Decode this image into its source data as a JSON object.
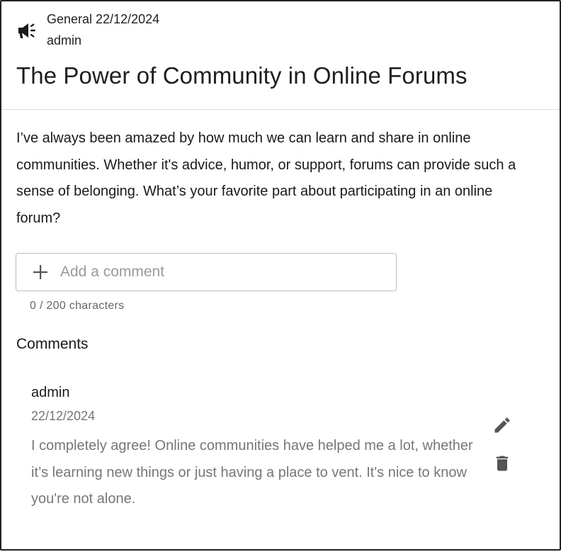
{
  "post": {
    "category": "General",
    "date": "22/12/2024",
    "author": "admin",
    "category_icon": "megaphone-icon",
    "title": "The Power of Community in Online Forums",
    "body": "I’ve always been amazed by how much we can learn and share in online communities. Whether it's advice, humor, or support, forums can provide such a sense of belonging. What’s your favorite part about participating in an online forum?"
  },
  "comment_input": {
    "placeholder": "Add a comment",
    "value": "",
    "icon": "plus-icon",
    "counter": "0 / 200 characters"
  },
  "comments_section": {
    "heading": "Comments",
    "items": [
      {
        "author": "admin",
        "date": "22/12/2024",
        "text": "I completely agree! Online communities have helped me a lot, whether it’s learning new things or just having a place to vent. It's nice to know you're not alone.",
        "actions": [
          "pencil-icon",
          "trash-icon"
        ]
      }
    ]
  },
  "colors": {
    "text_primary": "#1f1f1f",
    "text_secondary": "#777777",
    "icon": "#555555",
    "border": "#bdbdbd",
    "divider": "#dcdcdc"
  }
}
